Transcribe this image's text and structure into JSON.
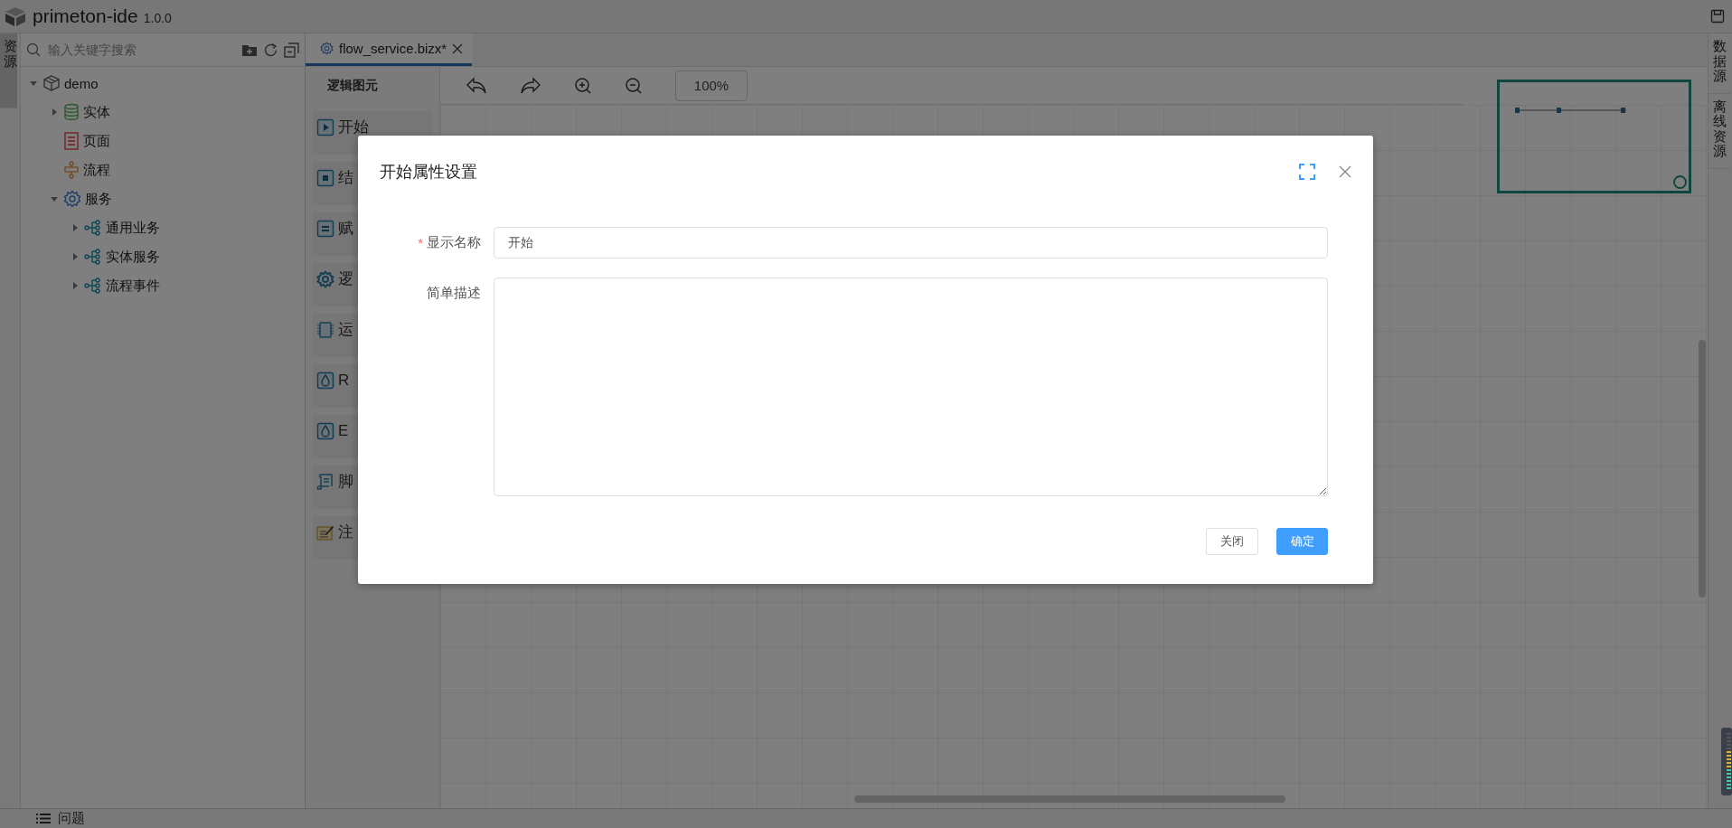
{
  "app": {
    "name": "primeton-ide",
    "version": "1.0.0"
  },
  "left_strip": [
    {
      "label": "资源",
      "selected": true
    }
  ],
  "resource_panel": {
    "search": {
      "placeholder": "输入关键字搜索"
    },
    "tree": [
      {
        "label": "demo",
        "kind": "project",
        "expanded": true,
        "children": [
          {
            "label": "实体",
            "kind": "entity",
            "expanded": false
          },
          {
            "label": "页面",
            "kind": "page"
          },
          {
            "label": "流程",
            "kind": "flow"
          },
          {
            "label": "服务",
            "kind": "service",
            "expanded": true,
            "children": [
              {
                "label": "通用业务",
                "kind": "group",
                "expanded": false
              },
              {
                "label": "实体服务",
                "kind": "group",
                "expanded": false
              },
              {
                "label": "流程事件",
                "kind": "group",
                "expanded": false
              }
            ]
          }
        ]
      }
    ]
  },
  "tabs": [
    {
      "label": "flow_service.bizx*",
      "selected": true
    }
  ],
  "palette": {
    "title": "逻辑图元",
    "items": [
      {
        "label": "开始",
        "kind": "start"
      },
      {
        "label": "结",
        "kind": "end"
      },
      {
        "label": "赋",
        "kind": "assign"
      },
      {
        "label": "逻",
        "kind": "logic"
      },
      {
        "label": "运",
        "kind": "operation"
      },
      {
        "label": "R",
        "kind": "rpc"
      },
      {
        "label": "E",
        "kind": "ec"
      },
      {
        "label": "脚",
        "kind": "script"
      },
      {
        "label": "注",
        "kind": "note"
      }
    ]
  },
  "toolbar": {
    "zoom": "100%"
  },
  "right_strip": [
    {
      "label": "数据源",
      "selected": false
    },
    {
      "label": "离线资源",
      "selected": false
    }
  ],
  "bottom_bar": {
    "problems": "问题"
  },
  "dialog": {
    "title": "开始属性设置",
    "fields": [
      {
        "label": "显示名称",
        "required_mark": "*",
        "kind": "input",
        "value": "开始"
      },
      {
        "label": "简单描述",
        "kind": "textarea"
      }
    ],
    "buttons": [
      {
        "label": "关闭",
        "primary": false
      },
      {
        "label": "确定",
        "primary": true
      }
    ]
  }
}
